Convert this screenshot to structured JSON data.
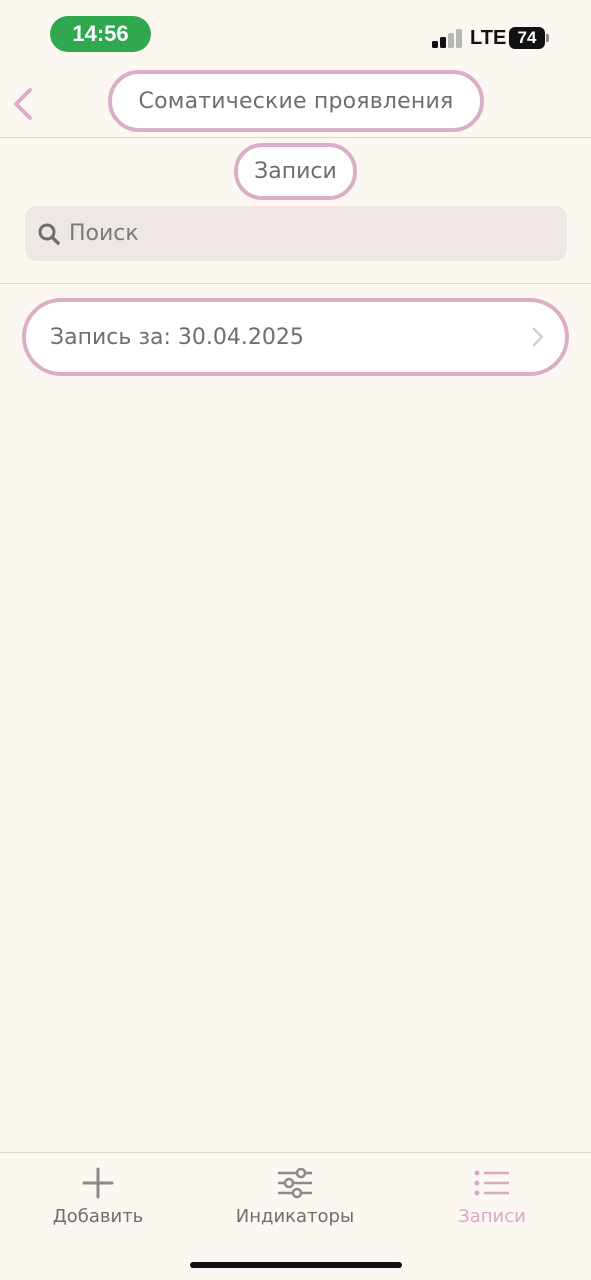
{
  "status_bar": {
    "time": "14:56",
    "network": "LTE",
    "battery": "74"
  },
  "header": {
    "title": "Соматические проявления"
  },
  "section": {
    "title": "Записи"
  },
  "search": {
    "placeholder": "Поиск"
  },
  "records": [
    {
      "label": "Запись за: 30.04.2025"
    }
  ],
  "tabbar": {
    "tabs": [
      {
        "label": "Добавить",
        "icon": "plus-icon",
        "active": false
      },
      {
        "label": "Индикаторы",
        "icon": "sliders-icon",
        "active": false
      },
      {
        "label": "Записи",
        "icon": "list-icon",
        "active": true
      }
    ]
  },
  "colors": {
    "accent": "#dbaec8",
    "active_tab": "#d9a8c4",
    "background": "#fdf7f2",
    "time_pill": "#2fa84f"
  }
}
